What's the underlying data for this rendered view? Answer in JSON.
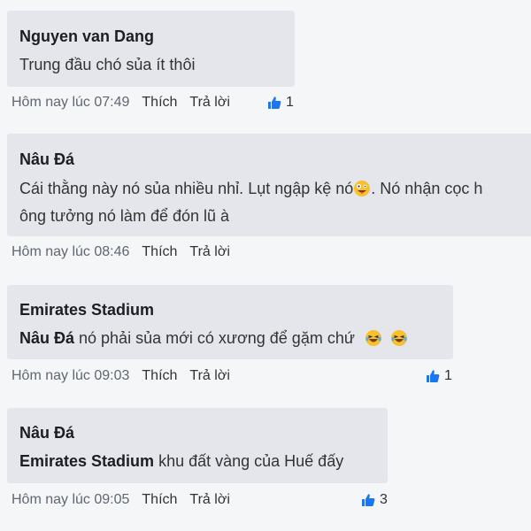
{
  "comments": [
    {
      "author": "Nguyen van Dang",
      "text": "Trung đầu chó sủa ít thôi",
      "time": "Hôm nay lúc 07:49",
      "like_label": "Thích",
      "reply_label": "Trả lời",
      "likes": "1"
    },
    {
      "author": "Nâu Đá",
      "text_line1_a": "Cái thằng này nó sủa nhiều nhỉ. Lụt ngập kệ nó",
      "text_line1_b": ". Nó nhận cọc h",
      "text_line2": "ông tưởng nó làm để đón lũ à",
      "emoji": "crazy-face-emoji",
      "time": "Hôm nay lúc 08:46",
      "like_label": "Thích",
      "reply_label": "Trả lời"
    },
    {
      "author": "Emirates Stadium",
      "mention": "Nâu Đá",
      "text": " nó phải sủa mới có xương để gặm chứ",
      "emoji": "laughing-tears-emoji",
      "time": "Hôm nay lúc 09:03",
      "like_label": "Thích",
      "reply_label": "Trả lời",
      "likes": "1"
    },
    {
      "author": "Nâu Đá",
      "mention": "Emirates Stadium",
      "text": " khu đất vàng của Huế đấy",
      "time": "Hôm nay lúc 09:05",
      "like_label": "Thích",
      "reply_label": "Trả lời",
      "likes": "3"
    }
  ],
  "colors": {
    "bubble": "#e4e6eb",
    "background": "#f5f6f7",
    "like_blue": "#1877f2",
    "emoji_yellow": "#f7c02c"
  }
}
